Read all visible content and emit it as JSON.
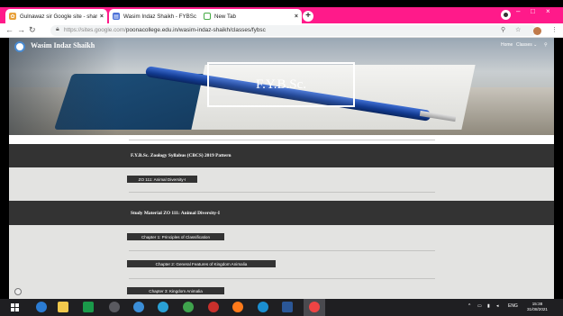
{
  "browser": {
    "tabs": [
      {
        "title": "Gulnawaz sir Google site - share",
        "favicon": "photos-icon",
        "active": false
      },
      {
        "title": "Wasim Indaz Shaikh - FYBSc",
        "favicon": "sites-icon",
        "active": true
      },
      {
        "title": "New Tab",
        "favicon": "chrome-icon",
        "active": false
      }
    ],
    "new_tab_label": "+",
    "url_host": "https://sites.google.com/",
    "url_path": "poonacollege.edu.in/wasim-indaz-shaikh/classes/fybsc",
    "window_controls": [
      "–",
      "□",
      "×"
    ]
  },
  "site": {
    "name": "Wasim Indaz Shaikh",
    "nav": [
      "Home",
      "Classes ⌄"
    ],
    "page_title": "F.Y.B.Sc."
  },
  "sections": [
    {
      "heading": "F.Y.B.Sc. Zoology Syllabus (CBCS) 2019 Pattern",
      "chips": [
        "ZO 111: Animal Diversity-I"
      ]
    },
    {
      "heading": "Study Material ZO 111: Animal Diversity-I",
      "chips": [
        "Chapter 1: Principles of Classification",
        "Chapter 2: General Features of Kingdom Animalia",
        "Chapter 3: Kingdom Animalia"
      ]
    }
  ],
  "taskbar": {
    "tray_language": "ENG",
    "time": "15:38",
    "date": "31/08/2021"
  },
  "colors": {
    "tabstrip": "#ff1a8a",
    "section_dark": "#333333",
    "page_bg": "#e3e3e1",
    "taskbar": "#1f1f22"
  }
}
